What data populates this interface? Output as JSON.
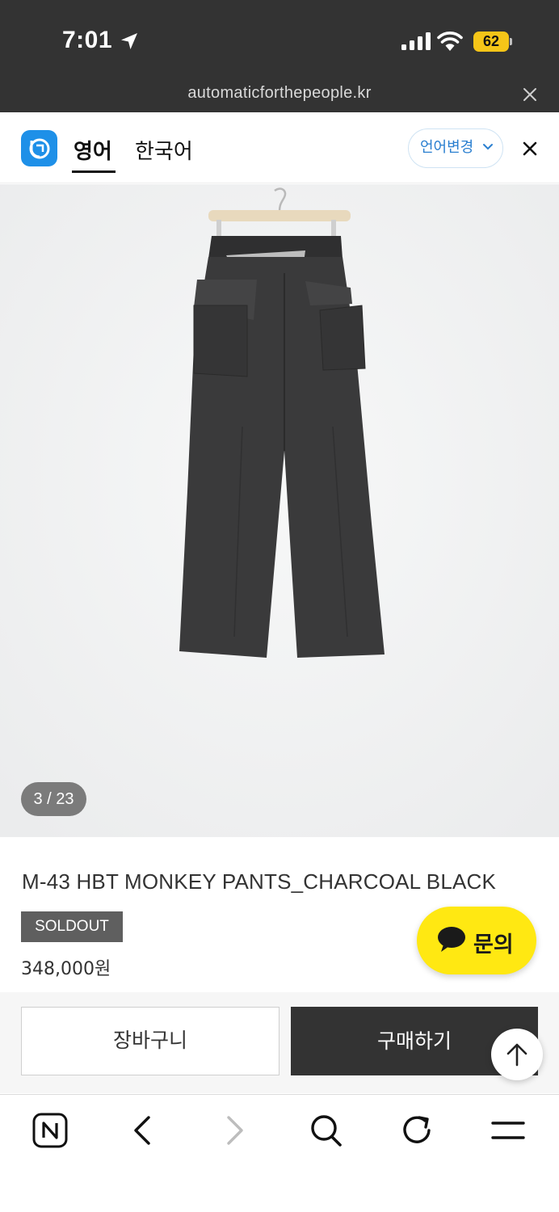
{
  "status_bar": {
    "time": "7:01",
    "battery": "62"
  },
  "browser": {
    "url": "automaticforthepeople.kr"
  },
  "translation_bar": {
    "tab_english": "영어",
    "tab_korean": "한국어",
    "change_language": "언어변경"
  },
  "product": {
    "image_counter": "3 / 23",
    "name": "M-43 HBT MONKEY PANTS_CHARCOAL BLACK",
    "badge": "SOLDOUT",
    "price": "348,000원"
  },
  "actions": {
    "inquiry": "문의",
    "cart": "장바구니",
    "buy": "구매하기"
  },
  "colors": {
    "header": "#333333",
    "accent_blue": "#1e90e8",
    "kakao_yellow": "#ffe812",
    "soldout": "#5f5f5f",
    "buy_button": "#333333"
  },
  "icons": [
    "location-arrow-icon",
    "signal-icon",
    "wifi-icon",
    "battery-icon",
    "close-icon",
    "papago-icon",
    "chevron-down-icon",
    "chat-bubble-icon",
    "arrow-up-icon",
    "naver-icon",
    "back-icon",
    "forward-icon",
    "search-icon",
    "reload-icon",
    "menu-icon"
  ]
}
